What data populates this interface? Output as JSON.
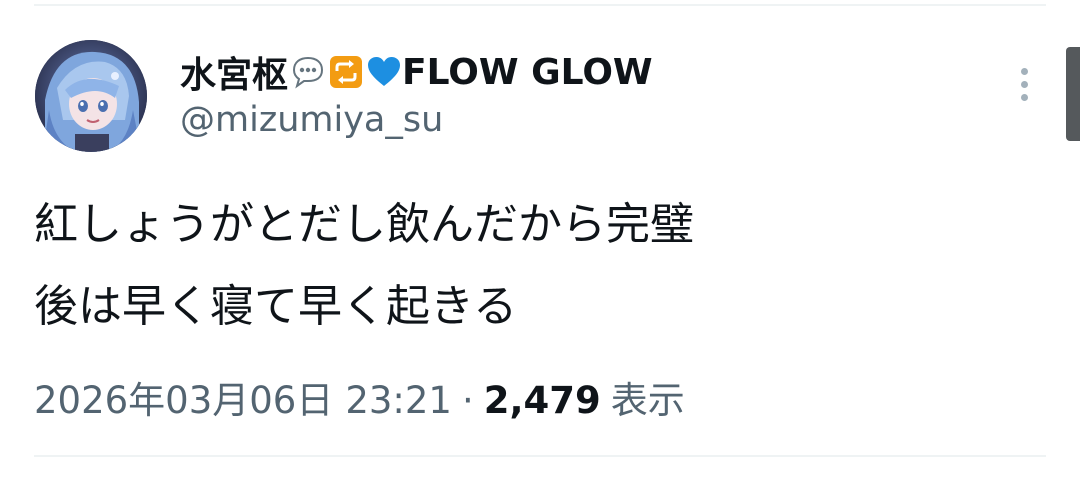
{
  "tweet": {
    "author": {
      "name": "水宮枢",
      "name_suffix": "FLOW GLOW",
      "emojis": [
        "speech-balloon-icon",
        "repeat-arrows-icon",
        "blue-heart-icon"
      ],
      "handle": "@mizumiya_su"
    },
    "text_lines": [
      "紅しょうがとだし飲んだから完璧",
      "後は早く寝て早く起きる"
    ],
    "date": "2026年03月06日",
    "time": "23:21",
    "separator": "·",
    "views_count": "2,479",
    "views_label": "表示"
  },
  "icons": {
    "more": "more-vertical-icon"
  },
  "colors": {
    "text_primary": "#0f1419",
    "text_secondary": "#536471",
    "divider": "#eff3f4",
    "more_dots": "#a3b1bb",
    "heart_blue": "#1d8fe1",
    "repeat_orange": "#f39c12"
  }
}
